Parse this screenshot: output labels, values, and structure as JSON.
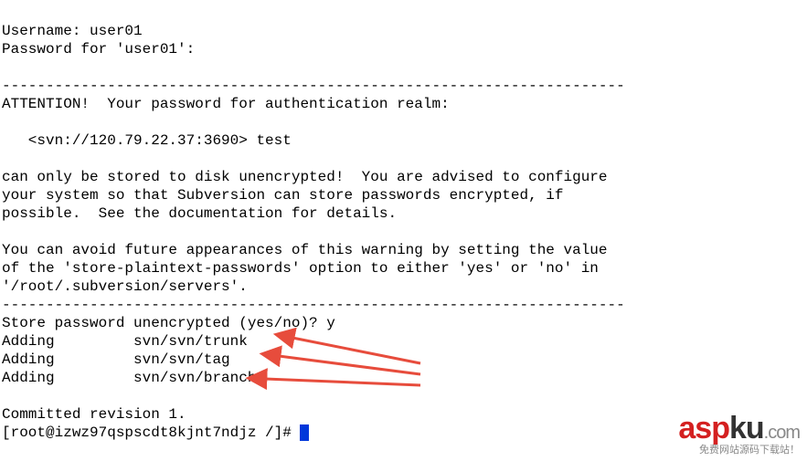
{
  "terminal": {
    "username_label": "Username: ",
    "username_value": "user01",
    "password_prompt": "Password for 'user01':",
    "divider1": "-----------------------------------------------------------------------",
    "attention": "ATTENTION!  Your password for authentication realm:",
    "realm": "   <svn://120.79.22.37:3690> test",
    "warn1": "can only be stored to disk unencrypted!  You are advised to configure",
    "warn2": "your system so that Subversion can store passwords encrypted, if",
    "warn3": "possible.  See the documentation for details.",
    "avoid1": "You can avoid future appearances of this warning by setting the value",
    "avoid2": "of the 'store-plaintext-passwords' option to either 'yes' or 'no' in",
    "avoid3": "'/root/.subversion/servers'.",
    "divider2": "-----------------------------------------------------------------------",
    "store_prompt": "Store password unencrypted (yes/no)? ",
    "store_answer": "y",
    "add1": "Adding         svn/svn/trunk",
    "add2": "Adding         svn/svn/tag",
    "add3": "Adding         svn/svn/branch",
    "committed": "Committed revision 1.",
    "prompt": "[root@izwz97qspscdt8kjnt7ndjz /]# "
  },
  "annotations": {
    "arrow_color": "#e74c3c"
  },
  "watermark": {
    "brand_red": "asp",
    "brand_black": "ku",
    "brand_domain": ".com",
    "tagline": "免费网站源码下载站！"
  }
}
